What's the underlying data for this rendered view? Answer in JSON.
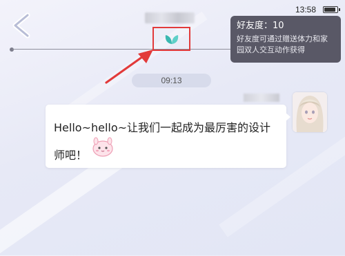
{
  "status_bar": {
    "time": "13:58"
  },
  "header": {
    "back_icon": "chevron-left-icon",
    "friend_icon": "leaf-icon",
    "friend_icon_color": "#3ab8b0",
    "highlight_color": "#e23a3a"
  },
  "tooltip": {
    "title": "好友度：10",
    "body": "好友度可通过赠送体力和家园双人交互动作获得"
  },
  "chat": {
    "time_divider": "09:13",
    "message": {
      "text": "Hello~hello~让我们一起成为最厉害的设计师吧！",
      "sticker_icon": "pink-bunny-sticker",
      "avatar_icon": "character-avatar"
    }
  }
}
